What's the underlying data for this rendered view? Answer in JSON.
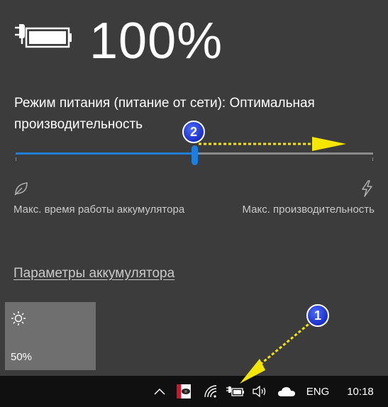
{
  "battery": {
    "percent_text": "100%",
    "icon": "plugged-battery-icon"
  },
  "power_mode": {
    "text": "Режим питания (питание от сети): Оптимальная производительность",
    "slider_level": 0.5,
    "left_label": "Макс. время работы аккумулятора",
    "right_label": "Макс. производительность",
    "left_icon": "leaf-icon",
    "right_icon": "lightning-icon"
  },
  "settings_link": "Параметры аккумулятора",
  "brightness": {
    "icon": "sun-icon",
    "value": "50%"
  },
  "taskbar": {
    "language": "ENG",
    "time": "10:18",
    "icons": [
      "chevron-up-icon",
      "app-icon",
      "wifi-icon",
      "battery-icon",
      "volume-icon",
      "cloud-icon"
    ]
  },
  "annotations": {
    "badge_1": "1",
    "badge_2": "2"
  },
  "colors": {
    "flyout_bg": "#3c3c3c",
    "accent": "#1f7fd6",
    "taskbar_bg": "#101010",
    "arrow": "#f5e600"
  }
}
